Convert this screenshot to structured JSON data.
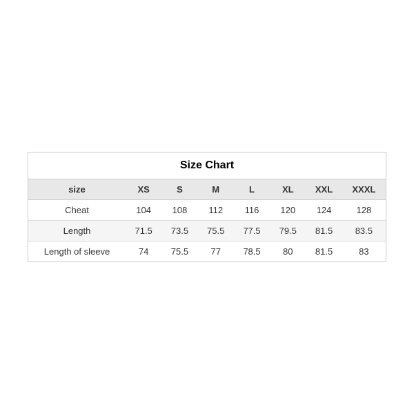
{
  "chart": {
    "title": "Size Chart",
    "headers": {
      "label": "size",
      "sizes": [
        "XS",
        "S",
        "M",
        "L",
        "XL",
        "XXL",
        "XXXL"
      ]
    },
    "rows": [
      {
        "label": "Cheat",
        "values": [
          "104",
          "108",
          "112",
          "116",
          "120",
          "124",
          "128"
        ]
      },
      {
        "label": "Length",
        "values": [
          "71.5",
          "73.5",
          "75.5",
          "77.5",
          "79.5",
          "81.5",
          "83.5"
        ]
      },
      {
        "label": "Length of sleeve",
        "values": [
          "74",
          "75.5",
          "77",
          "78.5",
          "80",
          "81.5",
          "83"
        ]
      }
    ]
  }
}
